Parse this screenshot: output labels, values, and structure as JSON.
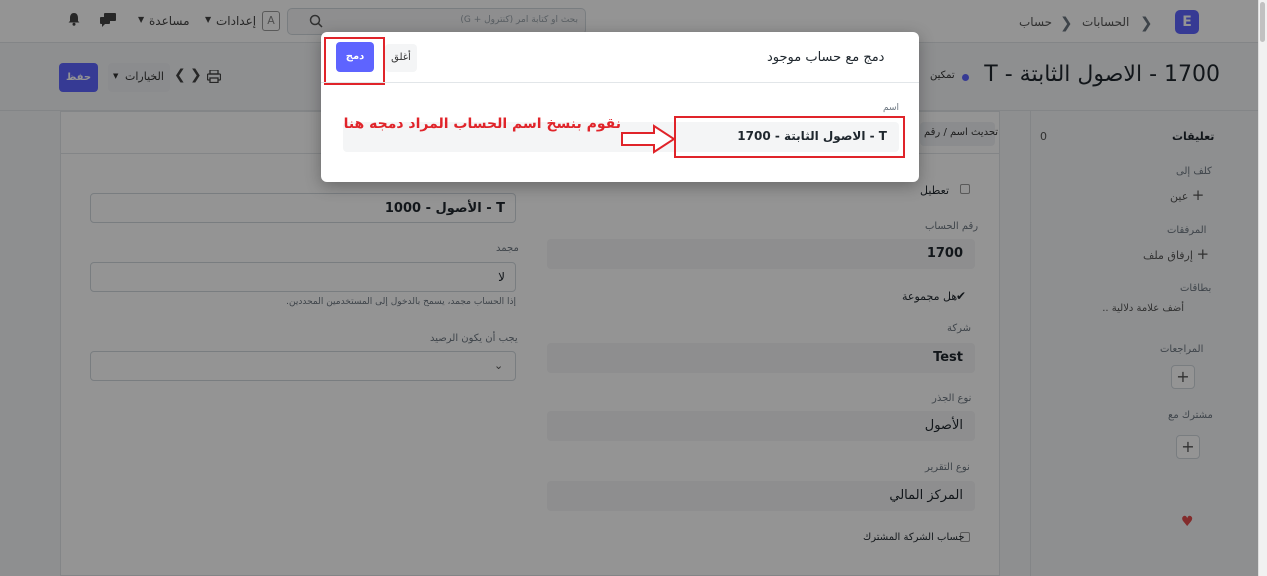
{
  "navbar": {
    "logo": "E",
    "breadcrumbs": [
      "الحسابات",
      "حساب"
    ],
    "search_placeholder": "بحث او كتابة أمر (كنترول + G)",
    "settings_label": "إعدادات",
    "avatar_letter": "A",
    "help_label": "مساعدة"
  },
  "page": {
    "title": "1700 - الاصول الثابتة - T",
    "status": "تمكين",
    "save_label": "حفظ",
    "actions_label": "الخيارات",
    "tab_label": "تحديث اسم / رقم"
  },
  "sidebar": {
    "comments_label": "تعليقات",
    "comments_count": "0",
    "assigned_label": "كلف إلى",
    "assign_action": "عين",
    "attachments_label": "المرفقات",
    "attach_action": "إرفاق ملف",
    "tags_label": "بطاقات",
    "add_tag": "أضف علامة دلالية ..",
    "reviews_label": "المراجعات",
    "shared_label": "مشترك مع"
  },
  "form": {
    "disable_label": "تعطيل",
    "account_number_label": "رقم الحساب",
    "account_number": "1700",
    "is_group_label": "هل مجموعة",
    "company_label": "شركة",
    "company": "Test",
    "root_type_label": "نوع الجذر",
    "root_type": "الأصول",
    "report_type_label": "نوع التقرير",
    "report_type": "المركز المالي",
    "common_account_label": "حساب الشركة المشترك",
    "parent_account": "1000 - الأصول - T",
    "frozen_label": "مجمد",
    "frozen_value": "لا",
    "frozen_help": "إذا الحساب مجمد، يسمح بالدخول إلى المستخدمين المحددين.",
    "balance_label": "يجب أن يكون الرصيد"
  },
  "modal": {
    "title": "دمج مع حساب موجود",
    "close_label": "أغلق",
    "merge_label": "دمج",
    "name_label": "اسم",
    "name_value": "1700 - الاصول الثابتة - T",
    "annotation": "نقوم بنسخ اسم الحساب المراد دمجه هنا"
  },
  "colors": {
    "primary": "#5e64ff",
    "annotation_red": "#e0242a"
  }
}
